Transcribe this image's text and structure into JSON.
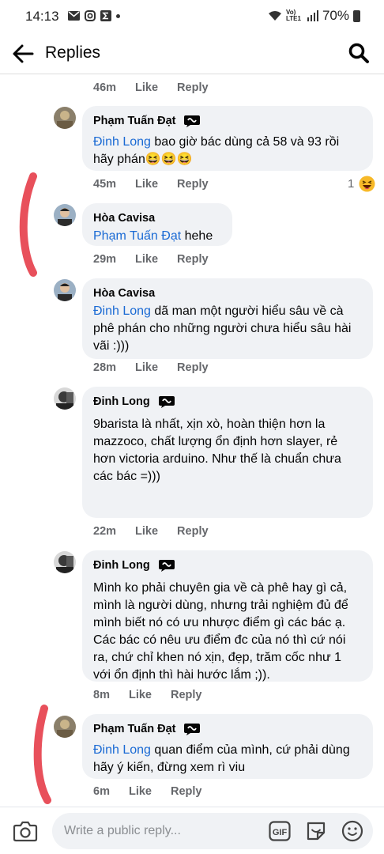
{
  "status_bar": {
    "time": "14:13",
    "signal_label": "Vo) LTE1",
    "battery": "70%"
  },
  "header": {
    "title": "Replies"
  },
  "actions": {
    "like": "Like",
    "reply": "Reply"
  },
  "top_meta": {
    "time": "46m"
  },
  "comments": [
    {
      "author": "Phạm Tuấn Đạt",
      "mention": "Đinh Long",
      "line1": " bao giờ bác dùng cả 58 và 93 rồi",
      "line2": "hãy phán😆😆😆",
      "time": "45m",
      "reaction_count": "1"
    },
    {
      "author": "Hòa Cavisa",
      "mention": "Phạm Tuấn Đạt",
      "line1": " hehe",
      "time": "29m"
    },
    {
      "author": "Hòa Cavisa",
      "mention": "Đinh Long",
      "line1": " dã man một người hiểu sâu về cà",
      "line2": "phê phán cho những người chưa hiểu sâu hài",
      "line3": "vãi :)))",
      "time": "28m"
    },
    {
      "author": "Đinh Long",
      "line1": "9barista là nhất, xịn xò, hoàn thiện hơn la",
      "line2": "mazzoco, chất lượng ổn định hơn slayer, rẻ",
      "line3": "hơn victoria arduino. Như thế là chuẩn chưa",
      "line4": "các bác =)))",
      "time": "22m"
    },
    {
      "author": "Đinh Long",
      "line1": "Mình ko phải chuyên gia về cà phê hay gì cả,",
      "line2": "mình là người dùng, nhưng trải nghiệm đủ để",
      "line3": "mình biết nó có ưu nhược điểm gì các bác ạ.",
      "line4": "Các bác có nêu ưu điểm đc của nó thì cứ nói",
      "line5": "ra, chứ chỉ khen nó xịn, đẹp, trăm cốc như 1",
      "line6": "với ổn định thì hài hước lắm ;)).",
      "time": "8m"
    },
    {
      "author": "Phạm Tuấn Đạt",
      "mention": "Đinh Long",
      "line1": " quan điểm của mình, cứ phải dùng",
      "line2": "hãy ý kiến, đừng xem rì viu",
      "time": "6m"
    }
  ],
  "composer": {
    "placeholder": "Write a public reply..."
  },
  "colors": {
    "mention": "#1a6ad4",
    "bubble": "#f0f2f5",
    "meta": "#65676b",
    "annotation": "#e8505b"
  }
}
